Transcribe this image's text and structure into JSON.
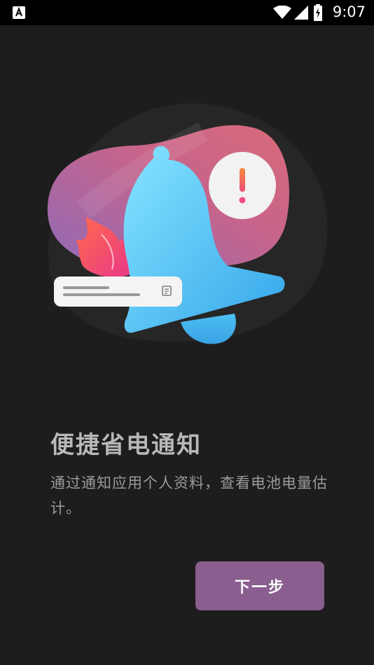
{
  "status_bar": {
    "time": "9:07",
    "left_icon": "accessibility-a-icon",
    "icons": [
      "wifi-icon",
      "cellular-signal-icon",
      "battery-charging-icon"
    ]
  },
  "illustration": {
    "icons": [
      "notification-bell-icon",
      "alert-exclamation-icon",
      "flame-icon",
      "notification-card-icon",
      "note-edit-icon"
    ],
    "colors": {
      "accent": "#8a5e8e",
      "blob_pink": "#c8648a",
      "blob_purple": "#8f6bb8",
      "bell_light": "#7fe0ff",
      "bell_dark": "#3aa8e8",
      "alert_orange": "#f57a3c",
      "alert_pink": "#f0507a"
    }
  },
  "content": {
    "title": "便捷省电通知",
    "description": "通过通知应用个人资料，查看电池电量估计。"
  },
  "actions": {
    "next_label": "下一步"
  },
  "colors": {
    "background": "#1d1d1d",
    "status_bar": "#000000",
    "title_text": "#b8b8b8",
    "description_text": "#9a9a9a",
    "button": "#8a5e8e"
  }
}
